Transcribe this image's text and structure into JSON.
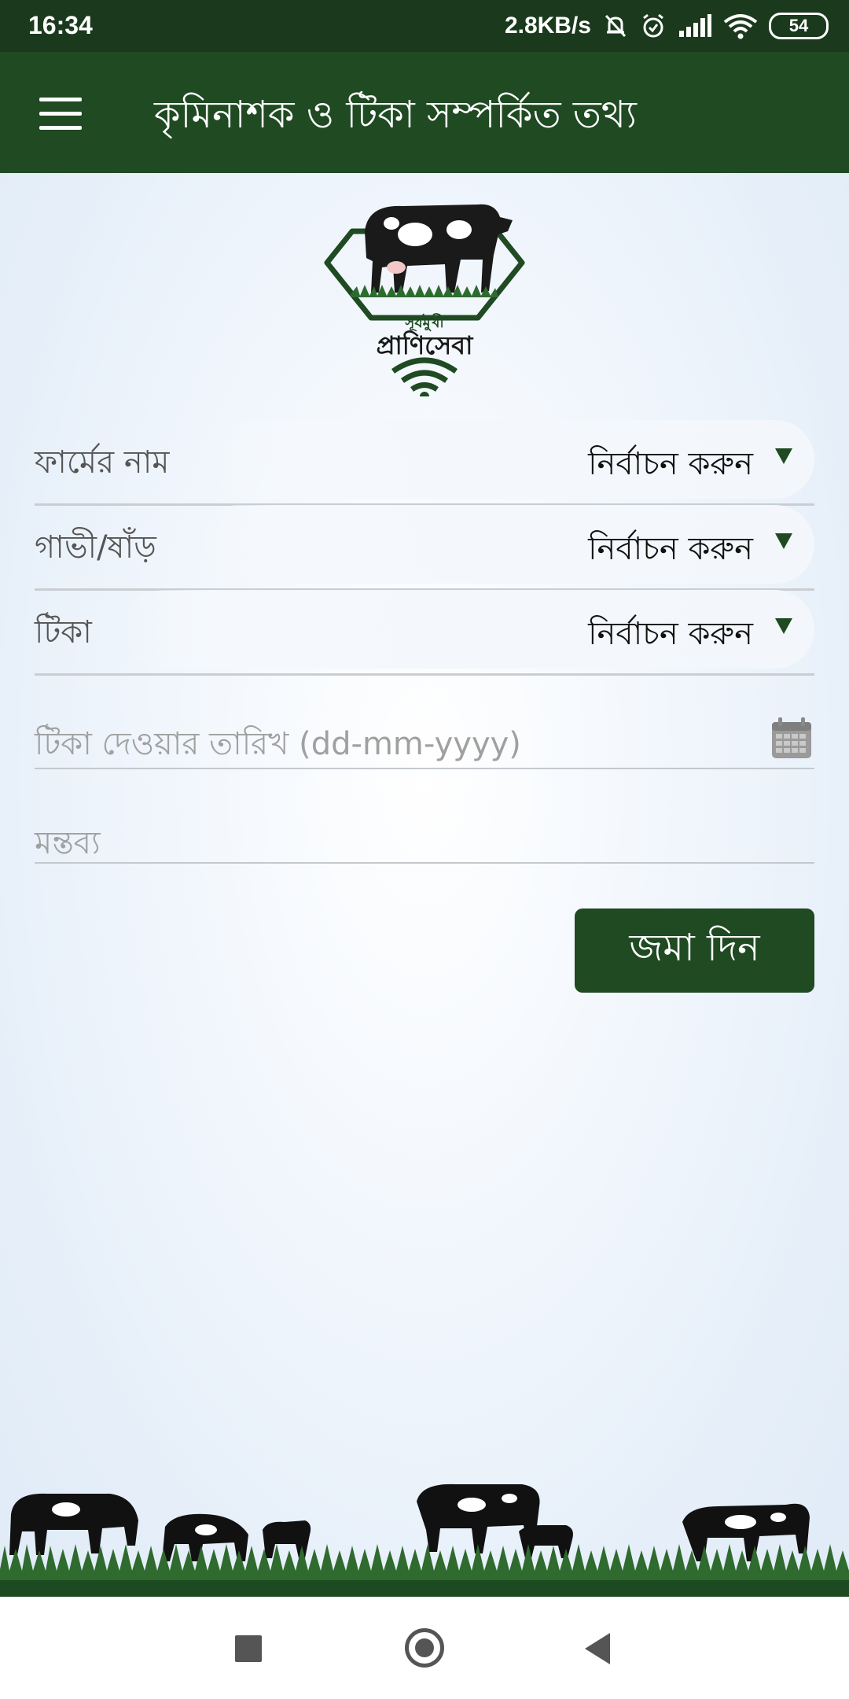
{
  "status_bar": {
    "time": "16:34",
    "net_speed": "2.8KB/s",
    "battery": "54"
  },
  "app_bar": {
    "title": "কৃমিনাশক ও টিকা সম্পর্কিত তথ্য"
  },
  "logo": {
    "line1": "সূর্যমুখী",
    "line2": "প্রাণিসেবা"
  },
  "form": {
    "farm": {
      "label": "ফার্মের নাম",
      "value": "নির্বাচন করুন"
    },
    "animal": {
      "label": "গাভী/ষাঁড়",
      "value": "নির্বাচন করুন"
    },
    "vaccine": {
      "label": "টিকা",
      "value": "নির্বাচন করুন"
    },
    "date_placeholder": "টিকা দেওয়ার তারিখ (dd-mm-yyyy)",
    "comment_placeholder": "মন্তব্য",
    "submit_label": "জমা দিন"
  },
  "colors": {
    "primary": "#1f4a22",
    "status_bar": "#1b3a1d",
    "background": "#e6eff9"
  }
}
